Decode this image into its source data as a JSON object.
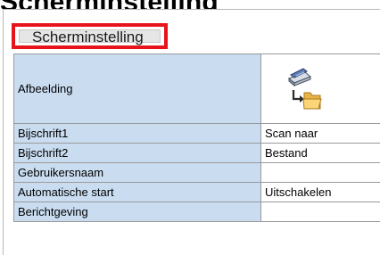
{
  "page": {
    "heading": "Scherminstelling"
  },
  "tab": {
    "label": "Scherminstelling"
  },
  "settings": {
    "image_label": "Afbeelding",
    "image_icon": "scan-to-folder-icon",
    "rows": [
      {
        "label": "Bijschrift1",
        "value": "Scan naar"
      },
      {
        "label": "Bijschrift2",
        "value": "Bestand"
      },
      {
        "label": "Gebruikersnaam",
        "value": ""
      },
      {
        "label": "Automatische start",
        "value": "Uitschakelen"
      },
      {
        "label": "Berichtgeving",
        "value": ""
      }
    ]
  },
  "colors": {
    "highlight_border": "#e8141c",
    "label_cell_background": "#c9dcf0",
    "tab_background": "#e6e6e6"
  }
}
